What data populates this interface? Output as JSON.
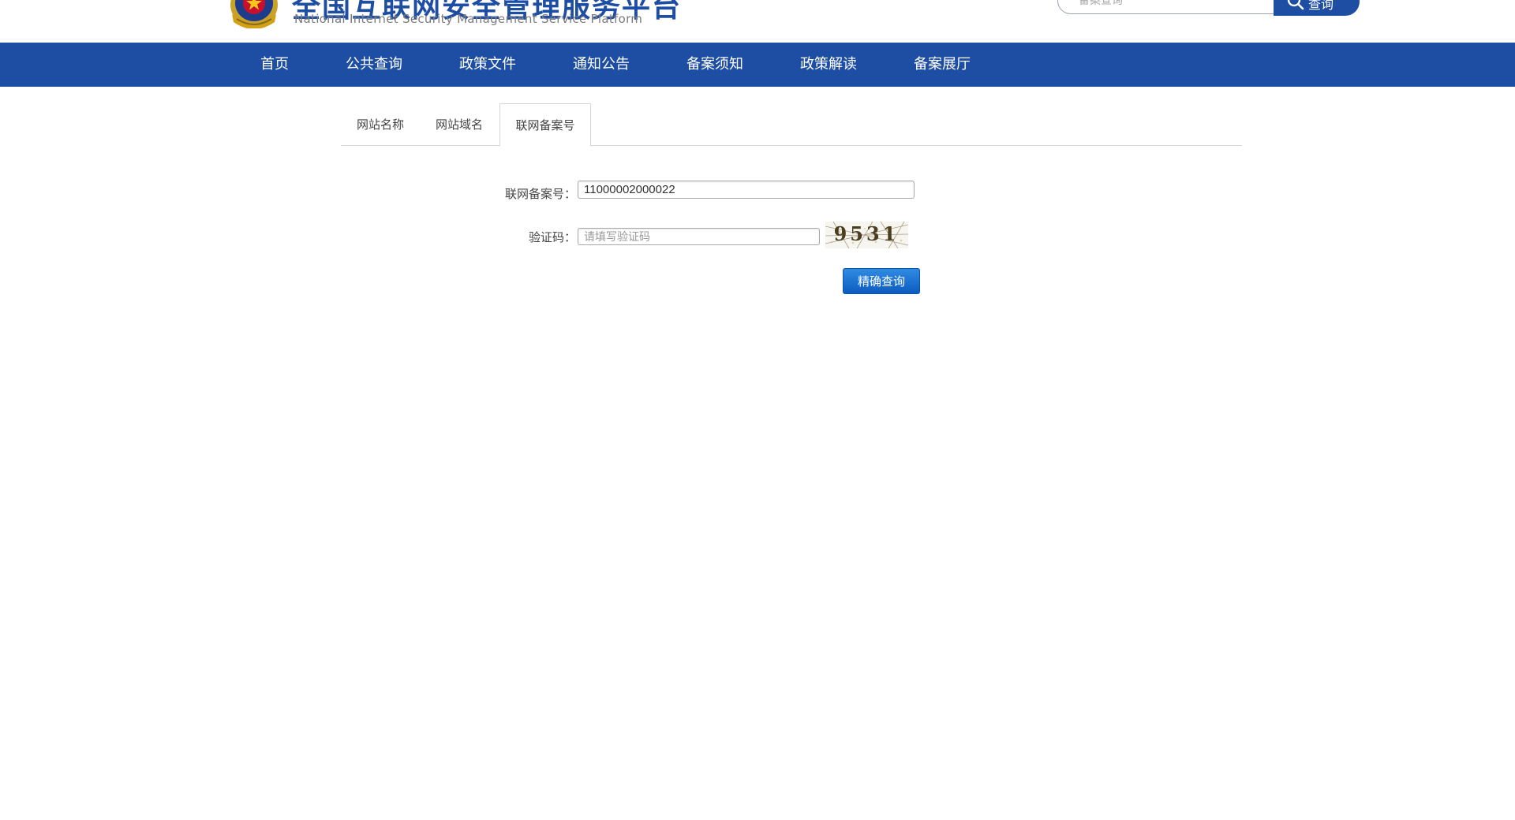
{
  "header": {
    "title": "全国互联网安全管理服务平台",
    "subtitle": "National Internet Security Management Service Platform",
    "search_placeholder": "备案查询",
    "search_button": "查询"
  },
  "nav": {
    "items": [
      "首页",
      "公共查询",
      "政策文件",
      "通知公告",
      "备案须知",
      "政策解读",
      "备案展厅"
    ]
  },
  "tabs": {
    "items": [
      "网站名称",
      "网站域名",
      "联网备案号"
    ],
    "active_index": 2
  },
  "form": {
    "record_label": "联网备案号：",
    "record_value": "11000002000022",
    "captcha_label": "验证码：",
    "captcha_placeholder": "请填写验证码",
    "captcha_text": "9531",
    "submit_label": "精确查询"
  },
  "colors": {
    "brand_blue": "#1e4ea3",
    "button_blue": "#1673d6",
    "captcha_ink": "#4a3e1e"
  }
}
